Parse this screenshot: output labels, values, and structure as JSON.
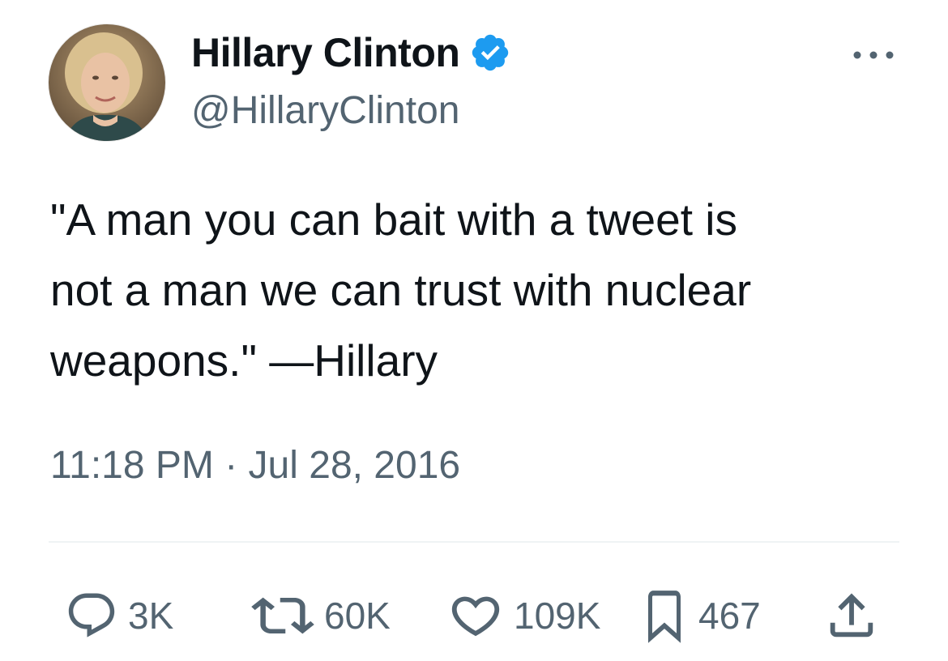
{
  "author": {
    "display_name": "Hillary Clinton",
    "handle": "@HillaryClinton",
    "verified": true,
    "verified_color": "#1d9bf0"
  },
  "tweet": {
    "text": "\"A man you can bait with a tweet is\nnot a man we can trust with nuclear\nweapons.\" —Hillary",
    "timestamp": "11:18 PM · Jul 28, 2016"
  },
  "actions": {
    "replies": {
      "icon": "reply-icon",
      "count": "3K"
    },
    "reposts": {
      "icon": "repost-icon",
      "count": "60K"
    },
    "likes": {
      "icon": "heart-icon",
      "count": "109K"
    },
    "bookmarks": {
      "icon": "bookmark-icon",
      "count": "467"
    },
    "share": {
      "icon": "share-icon"
    }
  },
  "colors": {
    "text": "#0f1419",
    "secondary_text": "#536471",
    "divider": "#eff3f4",
    "accent": "#1d9bf0"
  },
  "icons": {
    "more": "more-horizontal-icon"
  }
}
